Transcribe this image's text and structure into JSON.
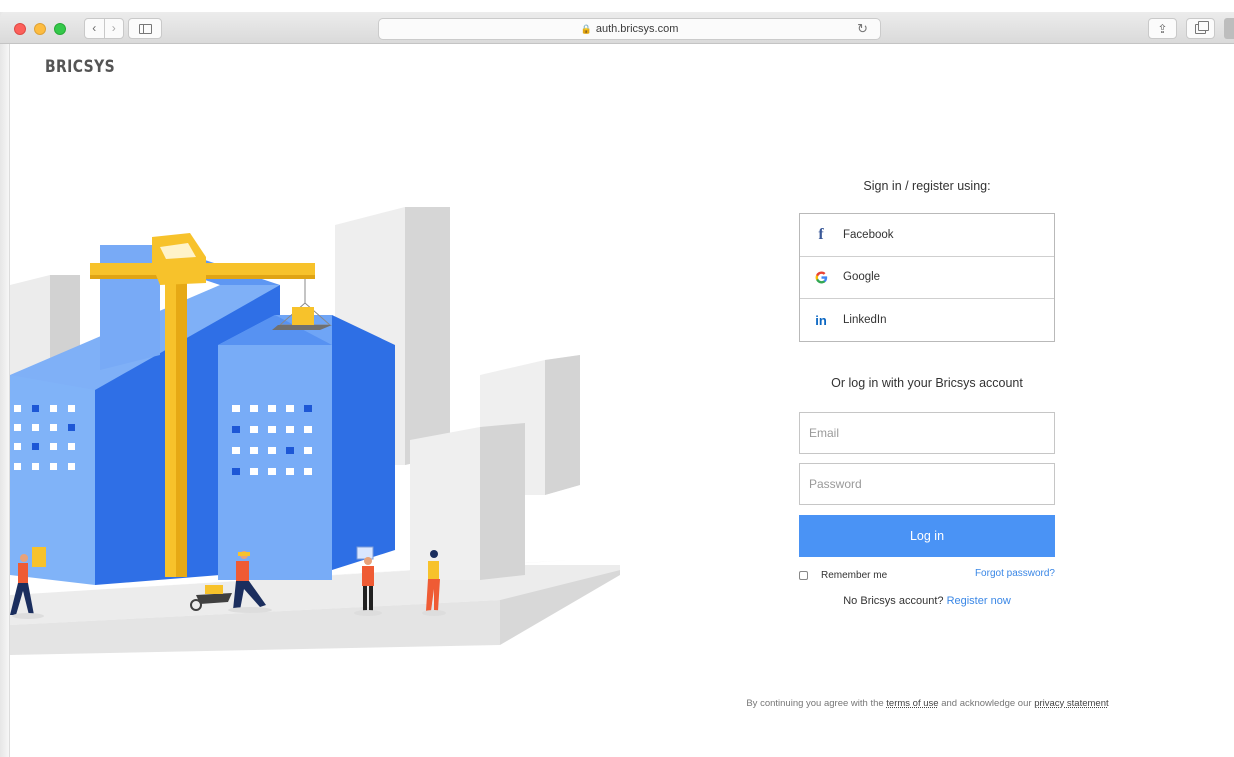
{
  "browser": {
    "url": "auth.bricsys.com",
    "nav_back": "‹",
    "nav_forward": "›",
    "lock_glyph": "🔒",
    "reload_glyph": "↻",
    "share_glyph": "⇪"
  },
  "logo": "BRICSYS",
  "signin": {
    "heading": "Sign in / register using:",
    "providers": [
      {
        "label": "Facebook",
        "icon": "f"
      },
      {
        "label": "Google",
        "icon": "G"
      },
      {
        "label": "LinkedIn",
        "icon": "in"
      }
    ]
  },
  "login": {
    "heading": "Or log in with your Bricsys account",
    "email_placeholder": "Email",
    "password_placeholder": "Password",
    "button_label": "Log in",
    "remember_label": "Remember me",
    "forgot_label": "Forgot password?",
    "no_account_text": "No Bricsys account?",
    "register_label": "Register now"
  },
  "footer": {
    "prefix": "By continuing you agree with the",
    "terms_label": "terms of use",
    "middle": "and acknowledge our",
    "privacy_label": "privacy statement"
  },
  "colors": {
    "primary": "#4a93f5",
    "link": "#3a87e6",
    "facebook": "#3b5998",
    "linkedin": "#0a66c2",
    "crane": "#f7c22b",
    "building_blue": "#3d7ef0"
  }
}
